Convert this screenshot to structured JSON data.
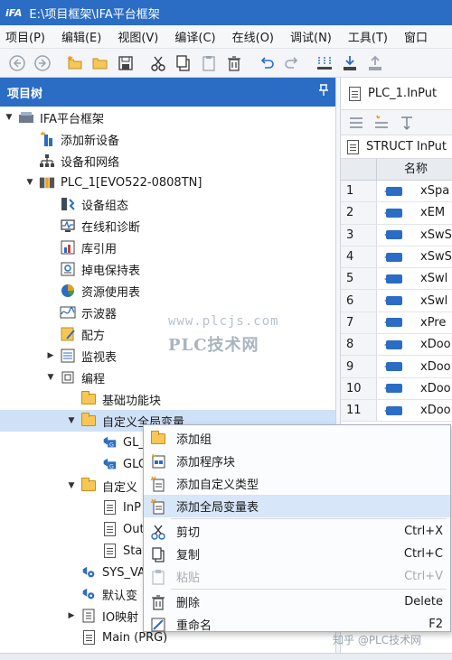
{
  "window": {
    "logo": "iFA",
    "title": "E:\\项目框架\\IFA平台框架"
  },
  "menu": [
    "项目(P)",
    "编辑(E)",
    "视图(V)",
    "编译(C)",
    "在线(O)",
    "调试(N)",
    "工具(T)",
    "窗口"
  ],
  "toolbar_icons": [
    "back-icon",
    "forward-icon",
    "new-icon",
    "open-icon",
    "save-icon",
    "cut-icon",
    "copy-icon",
    "paste-icon",
    "delete-icon",
    "undo-icon",
    "redo-icon",
    "build-icon",
    "download-icon",
    "upload-icon"
  ],
  "left_panel": {
    "title": "项目树",
    "pin": "¶",
    "tree": [
      {
        "label": "IFA平台框架",
        "indent": 0,
        "toggle": "▼",
        "icon": "project-icon"
      },
      {
        "label": "添加新设备",
        "indent": 1,
        "toggle": "",
        "icon": "add-device-icon"
      },
      {
        "label": "设备和网络",
        "indent": 1,
        "toggle": "",
        "icon": "network-icon"
      },
      {
        "label": "PLC_1[EVO522-0808TN]",
        "indent": 1,
        "toggle": "▼",
        "icon": "plc-icon"
      },
      {
        "label": "设备组态",
        "indent": 2,
        "toggle": "",
        "icon": "config-icon"
      },
      {
        "label": "在线和诊断",
        "indent": 2,
        "toggle": "",
        "icon": "diagnostic-icon"
      },
      {
        "label": "库引用",
        "indent": 2,
        "toggle": "",
        "icon": "library-icon"
      },
      {
        "label": "掉电保持表",
        "indent": 2,
        "toggle": "",
        "icon": "retain-icon"
      },
      {
        "label": "资源使用表",
        "indent": 2,
        "toggle": "",
        "icon": "resource-icon"
      },
      {
        "label": "示波器",
        "indent": 2,
        "toggle": "",
        "icon": "oscilloscope-icon"
      },
      {
        "label": "配方",
        "indent": 2,
        "toggle": "",
        "icon": "recipe-icon"
      },
      {
        "label": "监视表",
        "indent": 2,
        "toggle": "▶",
        "icon": "watch-icon"
      },
      {
        "label": "编程",
        "indent": 2,
        "toggle": "▼",
        "icon": "program-icon"
      },
      {
        "label": "基础功能块",
        "indent": 3,
        "toggle": "",
        "icon": "folder-icon"
      },
      {
        "label": "自定义全局变量",
        "indent": 3,
        "toggle": "▼",
        "icon": "folder-icon",
        "selected": true
      },
      {
        "label": "GL_",
        "indent": 4,
        "toggle": "",
        "icon": "global-var-icon"
      },
      {
        "label": "GLO",
        "indent": 4,
        "toggle": "",
        "icon": "global-var-icon"
      },
      {
        "label": "自定义",
        "indent": 3,
        "toggle": "▼",
        "icon": "folder-icon"
      },
      {
        "label": "InP",
        "indent": 4,
        "toggle": "",
        "icon": "struct-icon"
      },
      {
        "label": "Out",
        "indent": 4,
        "toggle": "",
        "icon": "struct-icon"
      },
      {
        "label": "Stat",
        "indent": 4,
        "toggle": "",
        "icon": "struct-icon"
      },
      {
        "label": "SYS_VA",
        "indent": 3,
        "toggle": "",
        "icon": "sys-var-icon"
      },
      {
        "label": "默认变",
        "indent": 3,
        "toggle": "",
        "icon": "default-var-icon"
      },
      {
        "label": "IO映射",
        "indent": 3,
        "toggle": "▶",
        "icon": "io-map-icon"
      },
      {
        "label": "Main (PRG)",
        "indent": 3,
        "toggle": "",
        "icon": "document-icon"
      }
    ]
  },
  "right_panel": {
    "tab_title": "PLC_1.InPut",
    "struct_label": "STRUCT InPut",
    "column_header": "名称",
    "rows": [
      {
        "num": "1",
        "name": "xSpa"
      },
      {
        "num": "2",
        "name": "xEM"
      },
      {
        "num": "3",
        "name": "xSwS"
      },
      {
        "num": "4",
        "name": "xSwS"
      },
      {
        "num": "5",
        "name": "xSwl"
      },
      {
        "num": "6",
        "name": "xSwl"
      },
      {
        "num": "7",
        "name": "xPre"
      },
      {
        "num": "8",
        "name": "xDoo"
      },
      {
        "num": "9",
        "name": "xDoo"
      },
      {
        "num": "10",
        "name": "xDoo"
      },
      {
        "num": "11",
        "name": "xDoo"
      }
    ]
  },
  "context_menu": [
    {
      "label": "添加组",
      "shortcut": "",
      "icon": "folder-icon",
      "highlight": false,
      "disabled": false
    },
    {
      "label": "添加程序块",
      "shortcut": "",
      "icon": "add-block-icon",
      "highlight": false,
      "disabled": false
    },
    {
      "label": "添加自定义类型",
      "shortcut": "",
      "icon": "add-type-icon",
      "highlight": false,
      "disabled": false
    },
    {
      "label": "添加全局变量表",
      "shortcut": "",
      "icon": "add-global-table-icon",
      "highlight": true,
      "disabled": false
    },
    {
      "label": "剪切",
      "shortcut": "Ctrl+X",
      "icon": "cut-icon",
      "highlight": false,
      "disabled": false
    },
    {
      "label": "复制",
      "shortcut": "Ctrl+C",
      "icon": "copy-icon",
      "highlight": false,
      "disabled": false
    },
    {
      "label": "粘贴",
      "shortcut": "Ctrl+V",
      "icon": "paste-icon",
      "highlight": false,
      "disabled": true
    },
    {
      "label": "删除",
      "shortcut": "Delete",
      "icon": "delete-icon",
      "highlight": false,
      "disabled": false
    },
    {
      "label": "重命名",
      "shortcut": "F2",
      "icon": "rename-icon",
      "highlight": false,
      "disabled": false
    }
  ],
  "watermarks": {
    "url": "www.plcjs.com",
    "site": "PLC技术网",
    "zhihu": "知乎 @PLC技术网"
  },
  "colors": {
    "accent": "#2b6cc4",
    "selection": "#cfe1f7",
    "menu_highlight": "#d7e6f8"
  }
}
